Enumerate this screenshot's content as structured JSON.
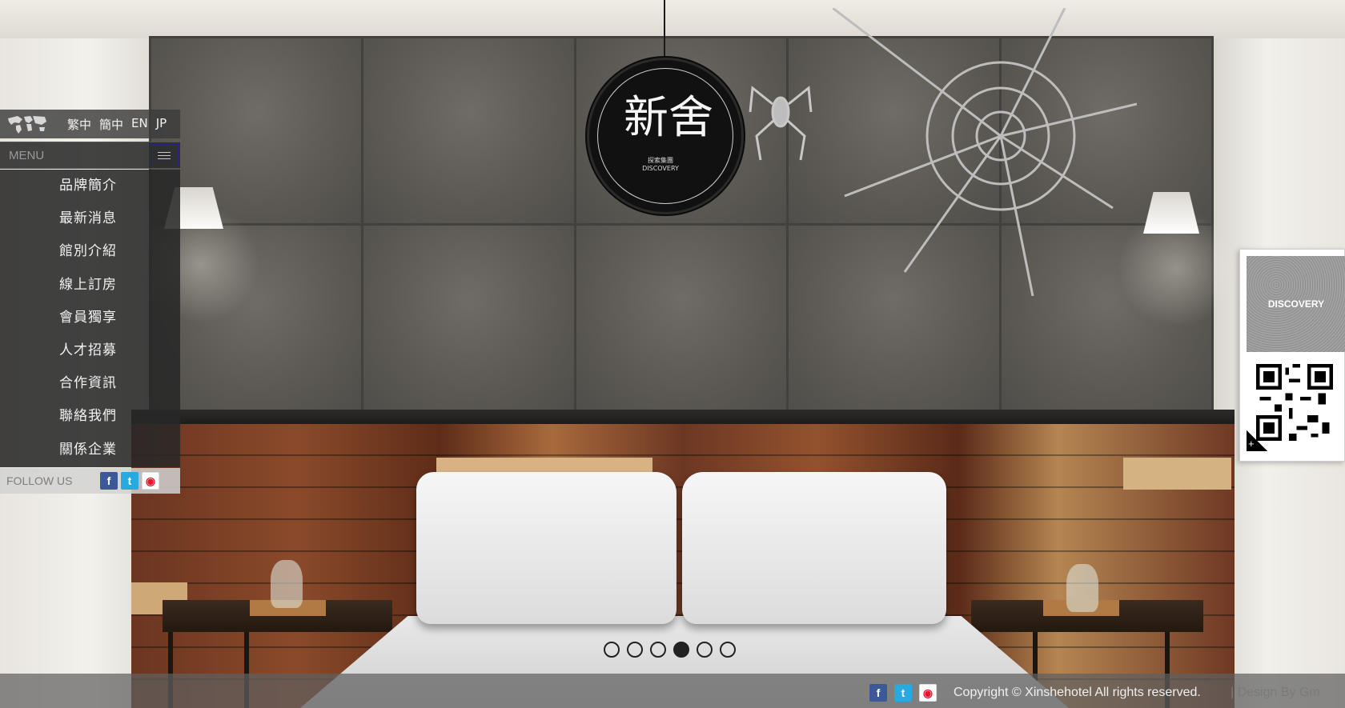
{
  "logo": {
    "name": "新舍",
    "subtitle": "探索集團",
    "subtitle_en": "DISCOVERY"
  },
  "languages": [
    "繁中",
    "簡中",
    "EN",
    "JP"
  ],
  "menu": {
    "label": "MENU",
    "items": [
      "品牌簡介",
      "最新消息",
      "館別介紹",
      "線上訂房",
      "會員獨享",
      "人才招募",
      "合作資訊",
      "聯絡我們",
      "關係企業"
    ]
  },
  "follow": {
    "label": "FOLLOW US"
  },
  "social_icons": [
    "facebook-icon",
    "twitter-icon",
    "weibo-icon"
  ],
  "qr_card": {
    "brand": "DISCOVERY",
    "plus": "+"
  },
  "slider": {
    "count": 6,
    "active_index": 4
  },
  "footer": {
    "copyright": "Copyright © Xinshehotel All rights reserved.",
    "design": "| Design By Gm"
  },
  "colors": {
    "facebook": "#3b5998",
    "twitter": "#28a9e0",
    "weibo": "#e6162d"
  }
}
